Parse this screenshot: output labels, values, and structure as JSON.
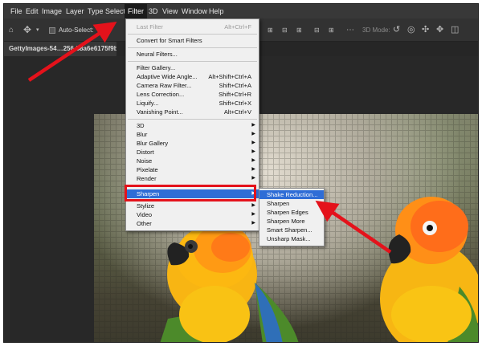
{
  "menubar": {
    "items": [
      "File",
      "Edit",
      "Image",
      "Layer",
      "Type",
      "Select",
      "Filter",
      "3D",
      "View",
      "Window",
      "Help"
    ]
  },
  "options_bar": {
    "auto_select_label": "Auto-Select:",
    "mode_3d_label": "3D Mode:"
  },
  "document": {
    "tab_title": "GettyImages-54…256-58a6e6175f9b"
  },
  "filter_menu": {
    "items": [
      {
        "label": "Last Filter",
        "shortcut": "Alt+Ctrl+F"
      },
      {
        "label": "Convert for Smart Filters"
      },
      {
        "label": "Neural Filters..."
      },
      {
        "label": "Filter Gallery..."
      },
      {
        "label": "Adaptive Wide Angle...",
        "shortcut": "Alt+Shift+Ctrl+A"
      },
      {
        "label": "Camera Raw Filter...",
        "shortcut": "Shift+Ctrl+A"
      },
      {
        "label": "Lens Correction...",
        "shortcut": "Shift+Ctrl+R"
      },
      {
        "label": "Liquify...",
        "shortcut": "Shift+Ctrl+X"
      },
      {
        "label": "Vanishing Point...",
        "shortcut": "Alt+Ctrl+V"
      },
      {
        "label": "3D"
      },
      {
        "label": "Blur"
      },
      {
        "label": "Blur Gallery"
      },
      {
        "label": "Distort"
      },
      {
        "label": "Noise"
      },
      {
        "label": "Pixelate"
      },
      {
        "label": "Render"
      },
      {
        "label": "Sharpen"
      },
      {
        "label": "Stylize"
      },
      {
        "label": "Video"
      },
      {
        "label": "Other"
      }
    ]
  },
  "sharpen_submenu": {
    "items": [
      "Shake Reduction...",
      "Sharpen",
      "Sharpen Edges",
      "Sharpen More",
      "Smart Sharpen...",
      "Unsharp Mask..."
    ]
  },
  "colors": {
    "highlight": "#2f6dd6",
    "annotation": "#e4121b"
  },
  "icons": {
    "submenu_arrow": "▶",
    "move_tool": "move-icon",
    "more_options": "ellipsis-icon"
  }
}
